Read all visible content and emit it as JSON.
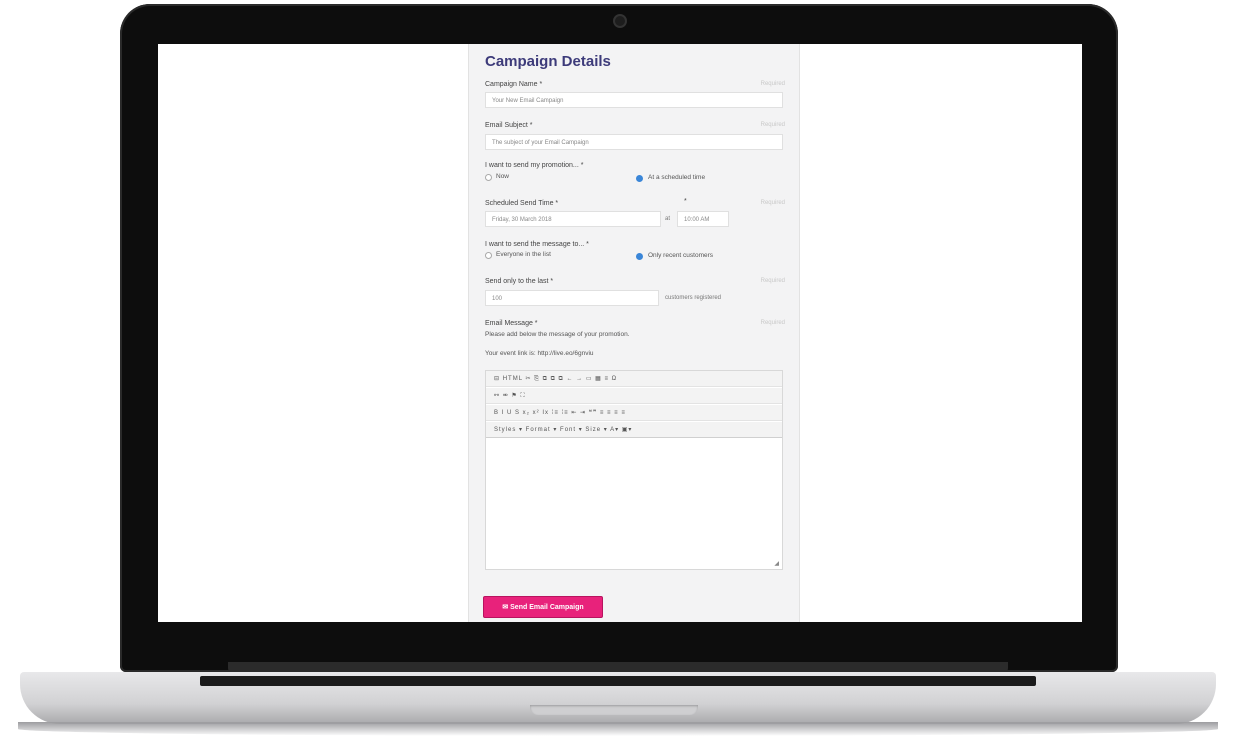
{
  "form": {
    "title": "Campaign Details",
    "campaign_name": {
      "label": "Campaign Name *",
      "value": "Your New Email Campaign",
      "required": "Required"
    },
    "email_subject": {
      "label": "Email Subject *",
      "value": "The subject of your Email Campaign",
      "required": "Required"
    },
    "send_when": {
      "label": "I want to send my promotion... *",
      "options": [
        "Now",
        "At a scheduled time"
      ],
      "selected": "At a scheduled time"
    },
    "scheduled_time": {
      "label": "Scheduled Send Time *",
      "asterisk": "*",
      "date": "Friday, 30 March 2018",
      "at": "at",
      "time": "10:00 AM",
      "required": "Required"
    },
    "send_to": {
      "label": "I want to send the message to... *",
      "options": [
        "Everyone in the list",
        "Only recent customers"
      ],
      "selected": "Only recent customers"
    },
    "send_last": {
      "label": "Send only to the last *",
      "value": "100",
      "suffix": "customers registered",
      "required": "Required"
    },
    "message": {
      "label": "Email Message *",
      "required": "Required",
      "hint": "Please add below the message of your promotion.",
      "event_link": "Your event link is: http://live.eo/6gnviu"
    },
    "editor": {
      "toolbar_row1": "⊟ HTML   ✂ ⎘  ⧉ ⧉ ⧉  ← →  ▭ ▦ ≡ Ω",
      "toolbar_row2": "⚯ ⚮ ⚑  ⛶",
      "toolbar_row3": "B I U S x₂ x² Ix  ⁞≡ ⁞≡  ⇤ ⇥ ❝❞  ≡ ≡ ≡ ≡",
      "toolbar_row4": "Styles ▾   Format ▾   Font ▾   Size ▾   A▾  ▣▾",
      "resize_glyph": "◢"
    },
    "submit_label": "✉ Send Email Campaign"
  },
  "colors": {
    "accent": "#e8227b",
    "title": "#3d3b7a",
    "radio": "#3a86d8"
  }
}
